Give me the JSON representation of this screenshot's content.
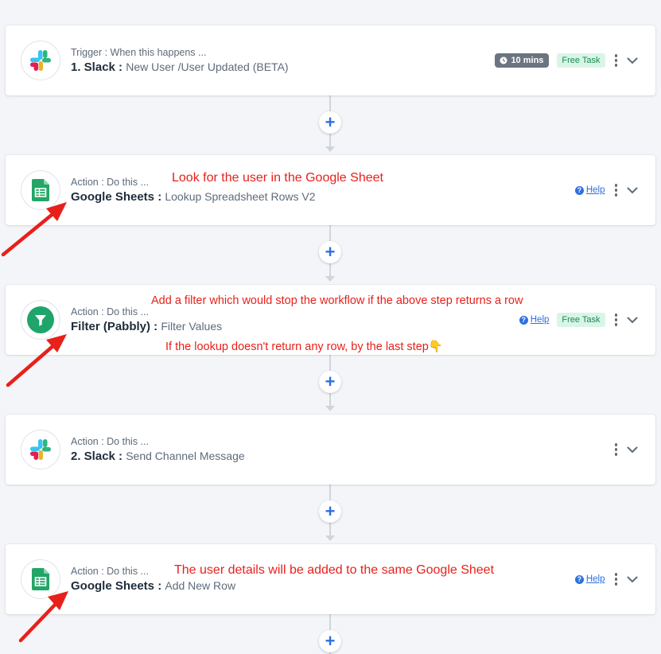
{
  "steps": [
    {
      "subtitle": "Trigger : When this happens ...",
      "app": "1. Slack :",
      "event": "New User /User Updated (BETA)",
      "logo": "slack-logo",
      "time_badge": "10 mins",
      "free_badge": "Free Task"
    },
    {
      "subtitle": "Action : Do this ...",
      "app": "Google Sheets :",
      "event": "Lookup Spreadsheet Rows V2",
      "logo": "google-sheets-logo",
      "help": "Help"
    },
    {
      "subtitle": "Action : Do this ...",
      "app": "Filter (Pabbly) :",
      "event": "Filter Values",
      "logo": "filter-logo",
      "help": "Help",
      "free_badge": "Free Task"
    },
    {
      "subtitle": "Action : Do this ...",
      "app": "2. Slack :",
      "event": "Send Channel Message",
      "logo": "slack-logo"
    },
    {
      "subtitle": "Action : Do this ...",
      "app": "Google Sheets :",
      "event": "Add New Row",
      "logo": "google-sheets-logo",
      "help": "Help"
    }
  ],
  "annotations": {
    "lookup": "Look for the user in the Google Sheet",
    "filter_top": "Add a filter which would stop the workflow if the above step returns a row",
    "filter_bottom": "If the lookup doesn't return any row, by the last step👇",
    "add_row": "The user details will be added to the same Google Sheet"
  },
  "colors": {
    "accent": "#2f6fe0",
    "annotation": "#e8201a",
    "sheets_green": "#23a566",
    "free_badge_bg": "#d9f5e7"
  }
}
